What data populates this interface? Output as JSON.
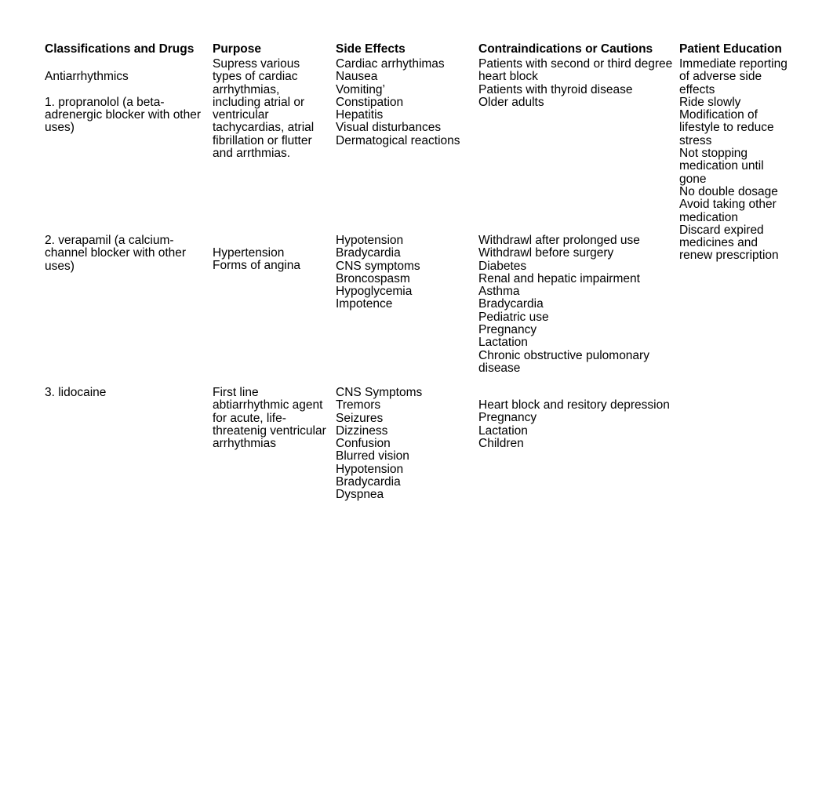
{
  "document": {
    "title": "Classifications and Drugs — Antiarrhythmics",
    "background_color": "#ffffff",
    "text_color": "#000000"
  },
  "table": {
    "headers": {
      "classifications": "Classifications and Drugs",
      "purpose": "Purpose",
      "side_effects": "Side Effects",
      "contraindications": "Contraindications or Cautions",
      "patient_education": "Patient Education"
    },
    "rows": [
      {
        "classifications": "Antiarrhythmics\n\n1. propranolol (a beta-adrenergic blocker with other uses)",
        "purpose": "Supress various types of cardiac arrhythmias, including atrial or ventricular tachycardias, atrial fibrillation or flutter and arrthmias.",
        "side_effects": "Cardiac arrhythimas\nNausea\nVomiting’\nConstipation\nHepatitis\nVisual disturbances\nDermatogical reactions",
        "contraindications": "Patients with second or third degree heart block\nPatients with thyroid disease\nOlder adults",
        "patient_education": "Immediate reporting of adverse side effects\nRide slowly\nModification of lifestyle to reduce stress\nNot stopping medication until gone\nNo double dosage\nAvoid taking other medication\nDiscard expired medicines and renew prescription"
      },
      {
        "classifications": "2. verapamil (a calcium-channel blocker with other uses)",
        "purpose": "Hypertension\nForms of angina",
        "side_effects": "Hypotension\nBradycardia\nCNS symptoms\nBroncospasm\nHypoglycemia\nImpotence",
        "contraindications": "Withdrawl after prolonged use\nWithdrawl before surgery\nDiabetes\nRenal and hepatic impairment\nAsthma\nBradycardia\nPediatric use\nPregnancy\nLactation\nChronic obstructive pulomonary disease",
        "patient_education": ""
      },
      {
        "classifications": "3. lidocaine",
        "purpose": "First line abtiarrhythmic agent for acute, life-threatenig ventricular arrhythmias",
        "side_effects": "CNS Symptoms\nTremors\nSeizures\nDizziness\nConfusion\nBlurred vision\nHypotension\nBradycardia\nDyspnea",
        "contraindications": "Heart block and resitory depression\nPregnancy\nLactation\nChildren",
        "patient_education": ""
      }
    ]
  }
}
